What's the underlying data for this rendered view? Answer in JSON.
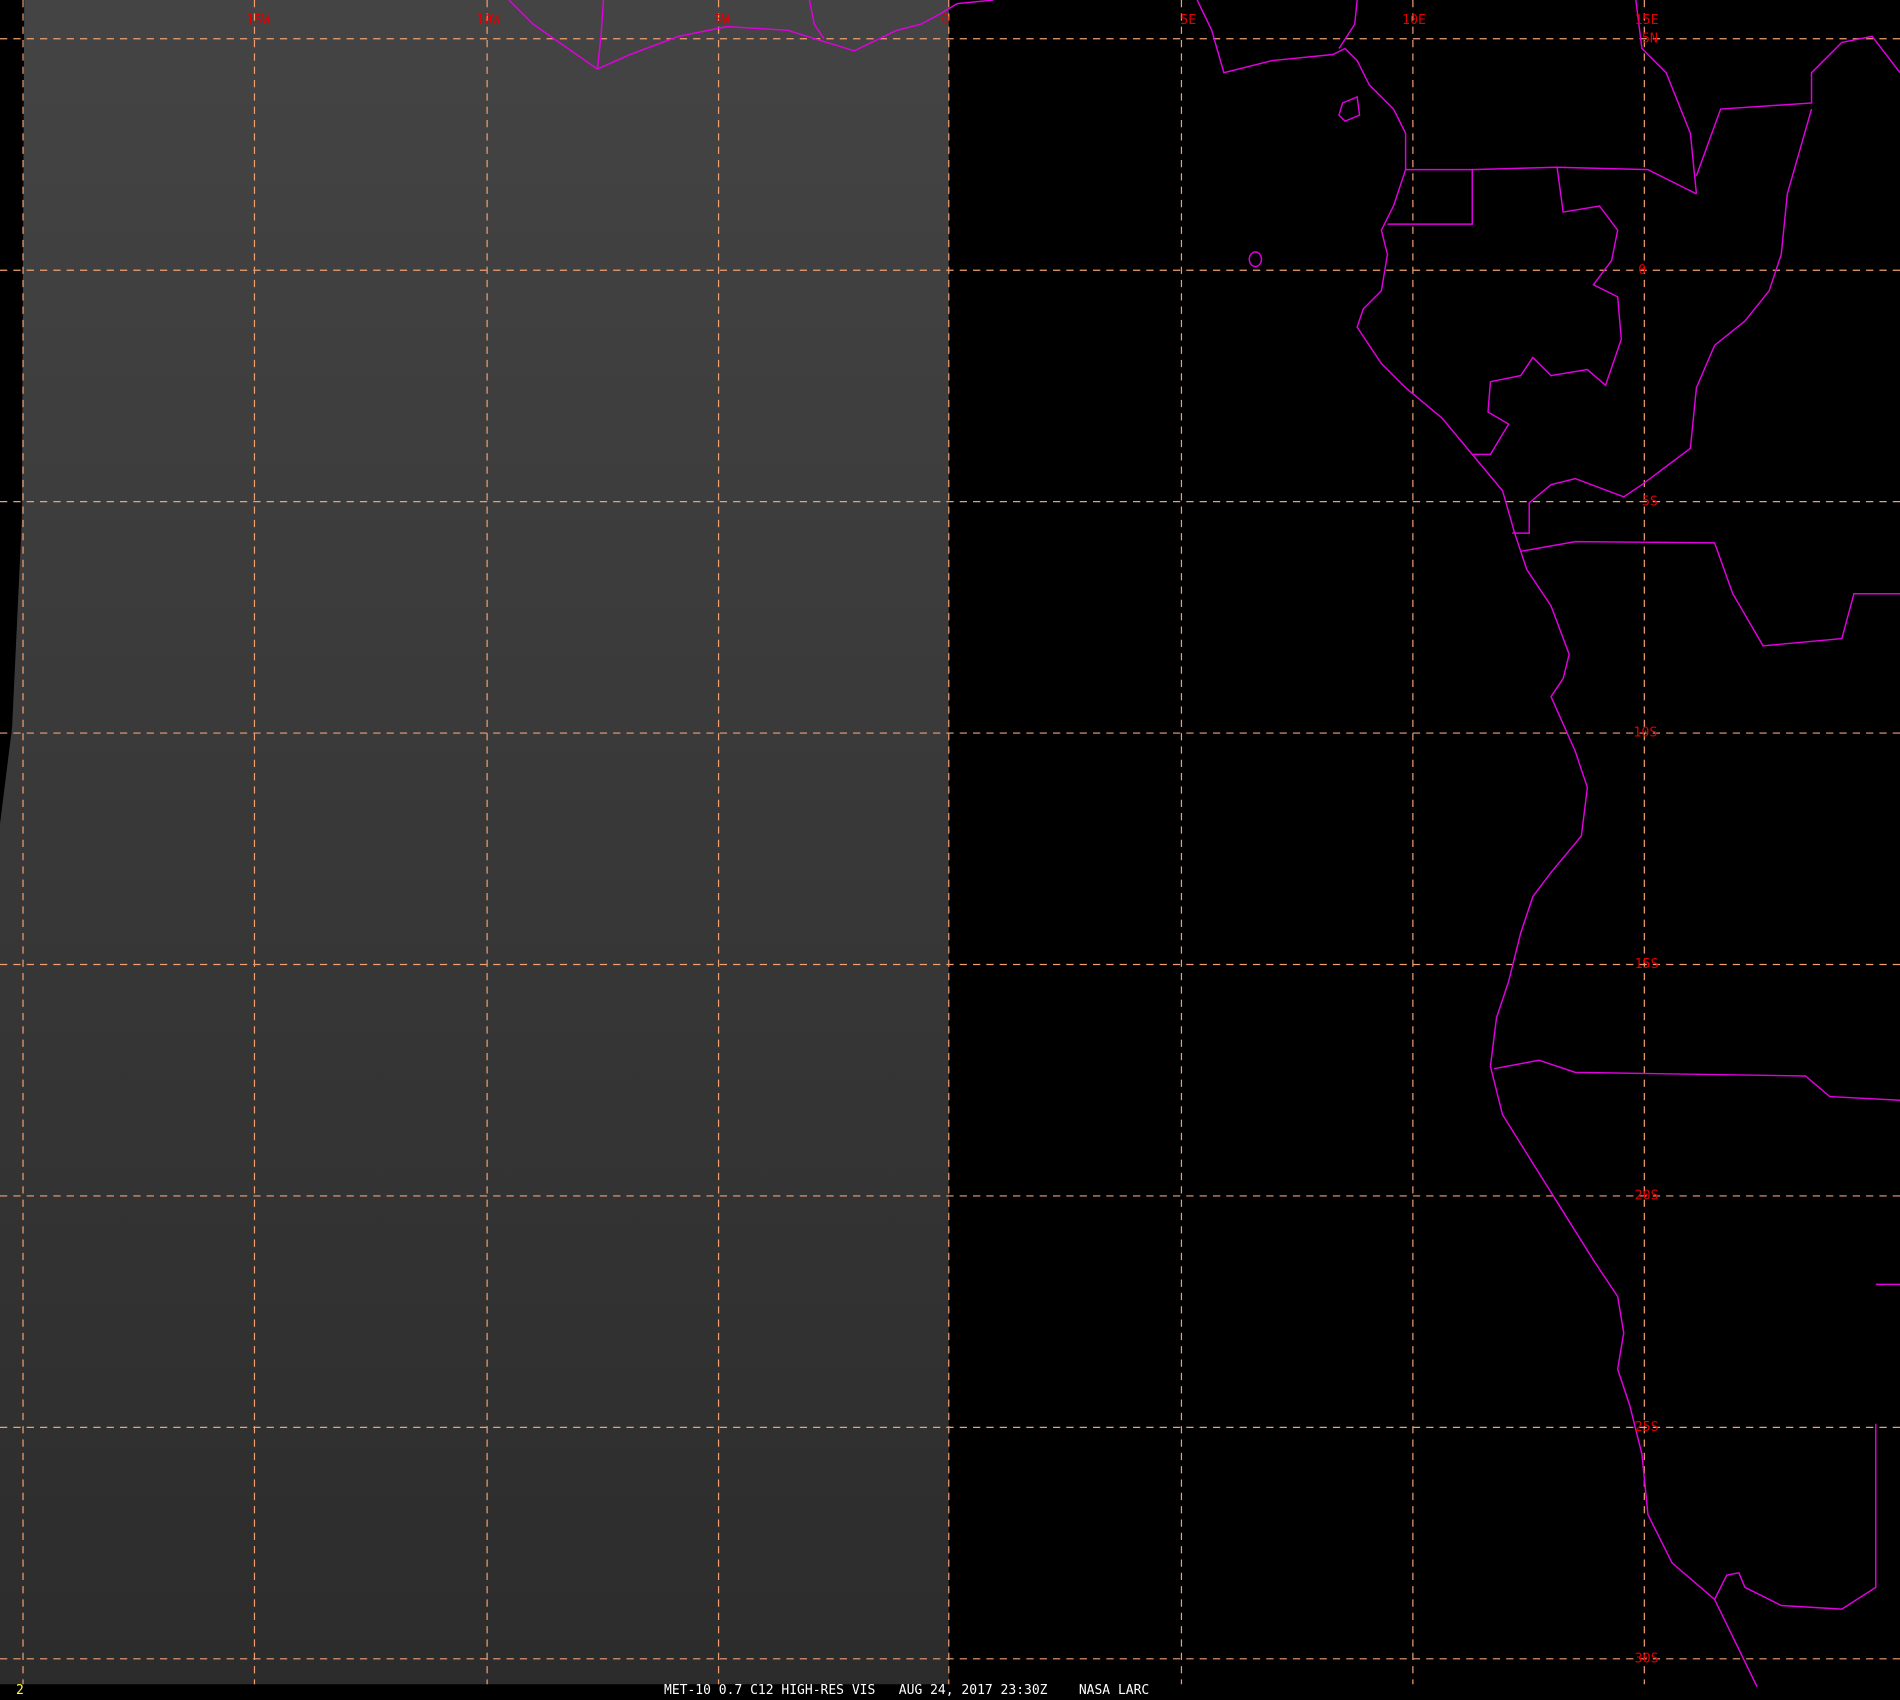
{
  "image": {
    "frame_number": "2",
    "caption": "MET-10 0.7 C12 HIGH-RES VIS   AUG 24, 2017 23:30Z    NASA LARC",
    "longitude_labels": [
      "15W",
      "10W",
      "5W",
      "0",
      "5E",
      "10E",
      "15E"
    ],
    "latitude_labels": [
      "5N",
      "0",
      "5S",
      "10S",
      "15S",
      "20S",
      "25S",
      "30S"
    ],
    "colors": {
      "grid": "#f0a070",
      "coastline": "#e000e0",
      "labels": "#e00000",
      "frame_number": "#ffff40",
      "visible_swath": "#3a3a3a"
    }
  }
}
